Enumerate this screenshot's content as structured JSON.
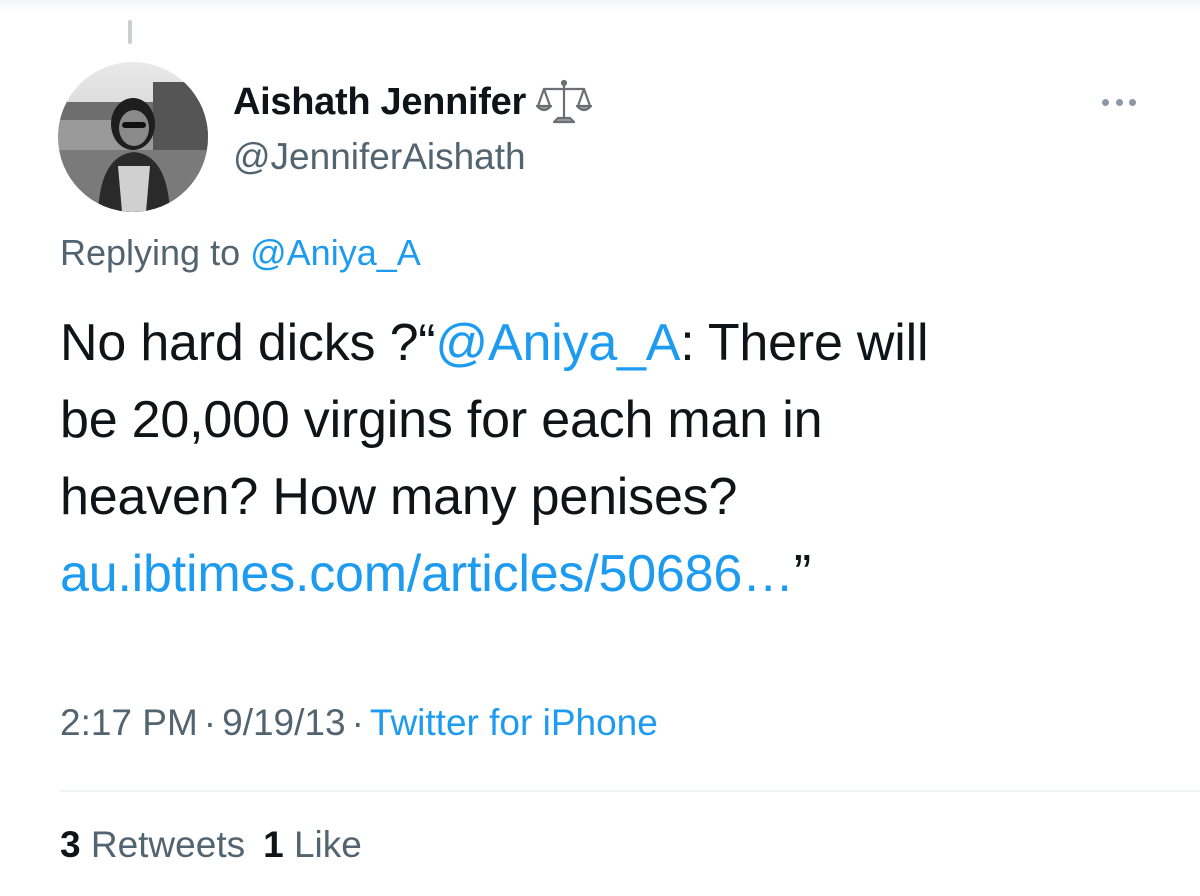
{
  "author": {
    "display_name": "Aishath Jennifer",
    "handle": "@JenniferAishath",
    "badge_icon": "balance-scale-icon",
    "avatar_icon": "profile-photo"
  },
  "more_icon": "more-horizontal-icon",
  "reply_context": {
    "prefix": "Replying to",
    "mention": "@Aniya_A"
  },
  "tweet": {
    "line1_text": "No hard dicks ?“",
    "line1_mention": "@Aniya_A",
    "line1_rest": ": There will",
    "line2": "be 20,000 virgins for each man in",
    "line3": "heaven? How many penises?",
    "line4_link": "au.ibtimes.com/articles/50686…",
    "line4_close_quote": "”"
  },
  "meta": {
    "time": "2:17 PM",
    "separator": "·",
    "date": "9/19/13",
    "source": "Twitter for iPhone"
  },
  "stats": {
    "retweets_count": "3",
    "retweets_label": "Retweets",
    "likes_count": "1",
    "likes_label": "Like"
  },
  "colors": {
    "text": "#0f1419",
    "secondary": "#536471",
    "link": "#1d9bf0",
    "divider": "#eff3f4"
  }
}
